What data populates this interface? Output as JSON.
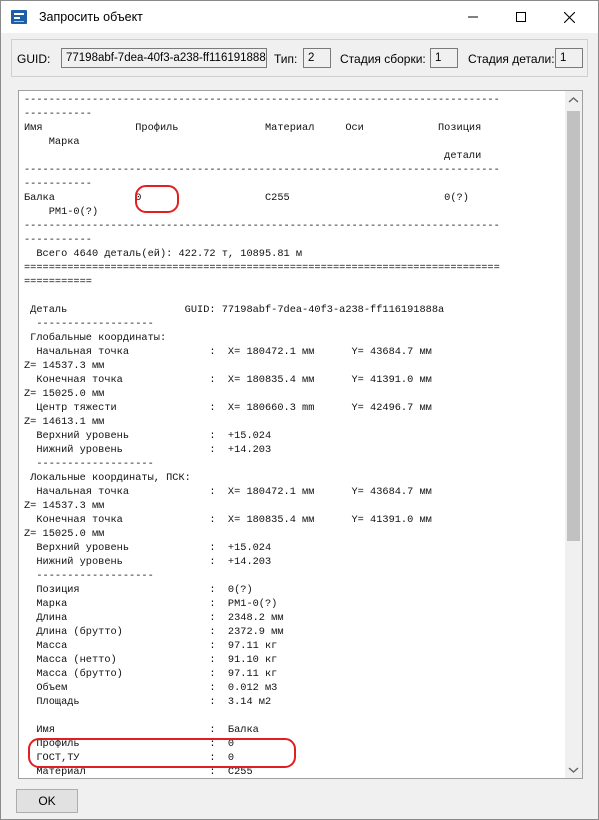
{
  "window": {
    "title": "Запросить объект"
  },
  "infobar": {
    "guid_label": "GUID:",
    "guid_value": "77198abf-7dea-40f3-a238-ff116191888",
    "type_label": "Тип:",
    "type_value": "2",
    "assembly_stage_label": "Стадия сборки:",
    "assembly_stage_value": "1",
    "part_stage_label": "Стадия детали:",
    "part_stage_value": "1"
  },
  "report": {
    "lines": [
      "-----------------------------------------------------------------------------",
      "-----------",
      "Имя               Профиль              Материал     Оси            Позиция",
      "    Марка",
      "                                                                    детали",
      "-----------------------------------------------------------------------------",
      "-----------",
      "Балка             0                    C255                         0(?)",
      "    PM1-0(?)",
      "-----------------------------------------------------------------------------",
      "-----------",
      "  Всего 4640 деталь(ей): 422.72 т, 10895.81 м",
      "=============================================================================",
      "===========",
      "",
      " Деталь                   GUID: 77198abf-7dea-40f3-a238-ff116191888a",
      "  -------------------",
      " Глобальные координаты:",
      "  Начальная точка             :  X= 180472.1 мм      Y= 43684.7 мм",
      "Z= 14537.3 мм",
      "  Конечная точка              :  X= 180835.4 мм      Y= 41391.0 мм",
      "Z= 15025.0 мм",
      "  Центр тяжести               :  X= 180660.3 mm      Y= 42496.7 мм",
      "Z= 14613.1 мм",
      "  Верхний уровень             :  +15.024",
      "  Нижний уровень              :  +14.203",
      "  -------------------",
      " Локальные координаты, ПСК:",
      "  Начальная точка             :  X= 180472.1 мм      Y= 43684.7 мм",
      "Z= 14537.3 мм",
      "  Конечная точка              :  X= 180835.4 мм      Y= 41391.0 мм",
      "Z= 15025.0 мм",
      "  Верхний уровень             :  +15.024",
      "  Нижний уровень              :  +14.203",
      "  -------------------",
      "  Позиция                     :  0(?)",
      "  Марка                       :  PM1-0(?)",
      "  Длина                       :  2348.2 мм",
      "  Длина (брутто)              :  2372.9 мм",
      "  Масса                       :  97.11 кг",
      "  Масса (нетто)               :  91.10 кг",
      "  Масса (брутто)              :  97.11 кг",
      "  Объем                       :  0.012 м3",
      "  Площадь                     :  3.14 м2",
      "",
      "  Имя                         :  Балка",
      "  Профиль                     :  0",
      "  ГОСТ,ТУ                     :  0",
      "  Материал                    :  C255"
    ]
  },
  "buttons": {
    "ok_label": "OK"
  },
  "colors": {
    "highlight": "#e02020",
    "scroll_thumb": "#c1c1c1"
  }
}
